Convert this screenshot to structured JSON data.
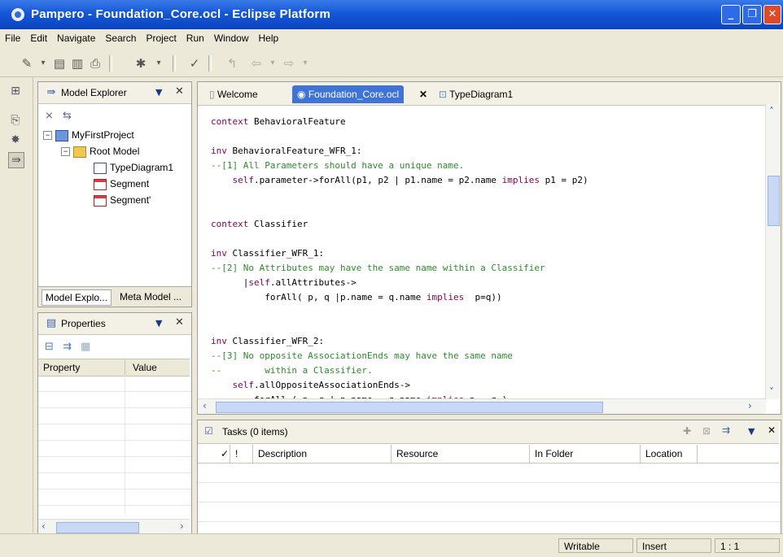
{
  "window": {
    "title": "Pampero - Foundation_Core.ocl - Eclipse Platform"
  },
  "menu": [
    "File",
    "Edit",
    "Navigate",
    "Search",
    "Project",
    "Run",
    "Window",
    "Help"
  ],
  "model_explorer": {
    "title": "Model Explorer",
    "tree": {
      "project": "MyFirstProject",
      "root": "Root Model",
      "children": [
        "TypeDiagram1",
        "Segment",
        "Segment'"
      ]
    },
    "bottom_tabs": [
      "Model Explo...",
      "Meta Model ..."
    ]
  },
  "properties": {
    "title": "Properties",
    "columns": [
      "Property",
      "Value"
    ]
  },
  "editor": {
    "tabs": [
      "Welcome",
      "Foundation_Core.ocl",
      "TypeDiagram1"
    ],
    "code_lines": [
      [
        [
          "kw",
          "context"
        ],
        [
          "n",
          " BehavioralFeature"
        ]
      ],
      [],
      [
        [
          "kw",
          "inv"
        ],
        [
          "n",
          " BehavioralFeature_WFR_1:"
        ]
      ],
      [
        [
          "cm",
          "--[1] All Parameters should have a unique name."
        ]
      ],
      [
        [
          "n",
          "    "
        ],
        [
          "kw",
          "self"
        ],
        [
          "n",
          ".parameter->forAll(p1, p2 | p1.name = p2.name "
        ],
        [
          "kw",
          "implies"
        ],
        [
          "n",
          " p1 = p2)"
        ]
      ],
      [],
      [],
      [
        [
          "kw",
          "context"
        ],
        [
          "n",
          " Classifier"
        ]
      ],
      [],
      [
        [
          "kw",
          "inv"
        ],
        [
          "n",
          " Classifier_WFR_1:"
        ]
      ],
      [
        [
          "cm",
          "--[2] No Attributes may have the same name within a Classifier"
        ]
      ],
      [
        [
          "n",
          "      |"
        ],
        [
          "kw",
          "self"
        ],
        [
          "n",
          ".allAttributes->"
        ]
      ],
      [
        [
          "n",
          "          forAll( p, q |p.name = q.name "
        ],
        [
          "kw",
          "implies"
        ],
        [
          "n",
          "  p=q))"
        ]
      ],
      [],
      [],
      [
        [
          "kw",
          "inv"
        ],
        [
          "n",
          " Classifier_WFR_2:"
        ]
      ],
      [
        [
          "cm",
          "--[3] No opposite AssociationEnds may have the same name"
        ]
      ],
      [
        [
          "cm",
          "--        within a Classifier."
        ]
      ],
      [
        [
          "n",
          "    "
        ],
        [
          "kw",
          "self"
        ],
        [
          "n",
          ".allOppositeAssociationEnds->"
        ]
      ],
      [
        [
          "n",
          "        forAll ( p, q | p.name = q.name "
        ],
        [
          "kw",
          "implies"
        ],
        [
          "n",
          " p = q )"
        ]
      ]
    ]
  },
  "tasks": {
    "title": "Tasks (0 items)",
    "columns": [
      "✓",
      "!",
      "Description",
      "Resource",
      "In Folder",
      "Location"
    ]
  },
  "status": {
    "writable": "Writable",
    "insert": "Insert",
    "position": "1 : 1"
  }
}
